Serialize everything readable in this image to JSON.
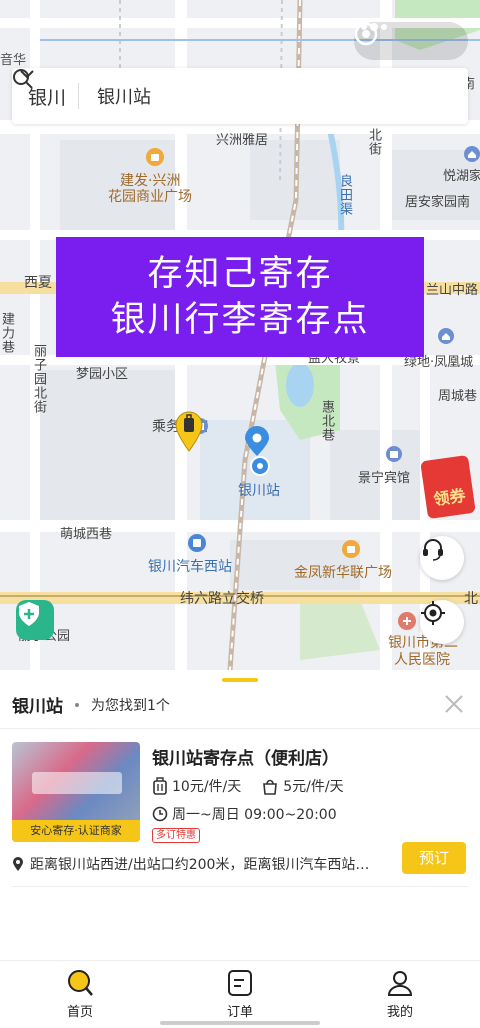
{
  "search": {
    "city": "银川",
    "query": "银川站"
  },
  "banner": {
    "line1": "存知己寄存",
    "line2": "银川行李寄存点"
  },
  "map": {
    "labels": {
      "yinlin": "音华",
      "xingzhou": "兴洲雅居",
      "beijie": "北街",
      "jianfa1": "建发·兴洲",
      "jianfa2": "花园商业广场",
      "liangtian": "良田渠",
      "yuehu": "悦湖家",
      "juan": "居安家园南",
      "xixia": "西夏",
      "lanshan": "兰山中路",
      "jianli": "建力巷",
      "lizi": "丽子园北街",
      "mengyuan": "梦园小区",
      "jingcheng": "盐大牧景",
      "lvdi": "绿地·凤凰城",
      "zhoucheng": "周城巷",
      "huibei": "惠北巷",
      "hotel": "乘务宾馆",
      "station": "银川站",
      "jingning": "景宁宾馆",
      "mengcheng": "萌城西巷",
      "bus": "银川汽车西站",
      "jinfeng": "金凤新华联广场",
      "weiliu": "纬六路立交桥",
      "park": "丽子公园",
      "hospital1": "银川市第二",
      "hospital2": "人民医院",
      "bei": "北",
      "nan": "南"
    },
    "coupon": "领券"
  },
  "sheet": {
    "station": "银川站",
    "found": "为您找到1个",
    "shop": {
      "name": "银川站寄存点（便利店）",
      "price_piece": "10元/件/天",
      "price_bag": "5元/件/天",
      "hours": "周一~周日 09:00~20:00",
      "promo": "多订特惠",
      "tag": "安心寄存·认证商家",
      "distance": "距离银川站西进/出站口约200米，距离银川汽车西站…",
      "reserve": "预订"
    }
  },
  "tabs": [
    {
      "label": "首页",
      "icon": "search-icon",
      "active": true
    },
    {
      "label": "订单",
      "icon": "order-icon",
      "active": false
    },
    {
      "label": "我的",
      "icon": "user-icon",
      "active": false
    }
  ],
  "colors": {
    "accent": "#f5c518",
    "banner": "#7a1ef0",
    "map_blue": "#3a8de0",
    "park_green": "#c6e8c0"
  }
}
